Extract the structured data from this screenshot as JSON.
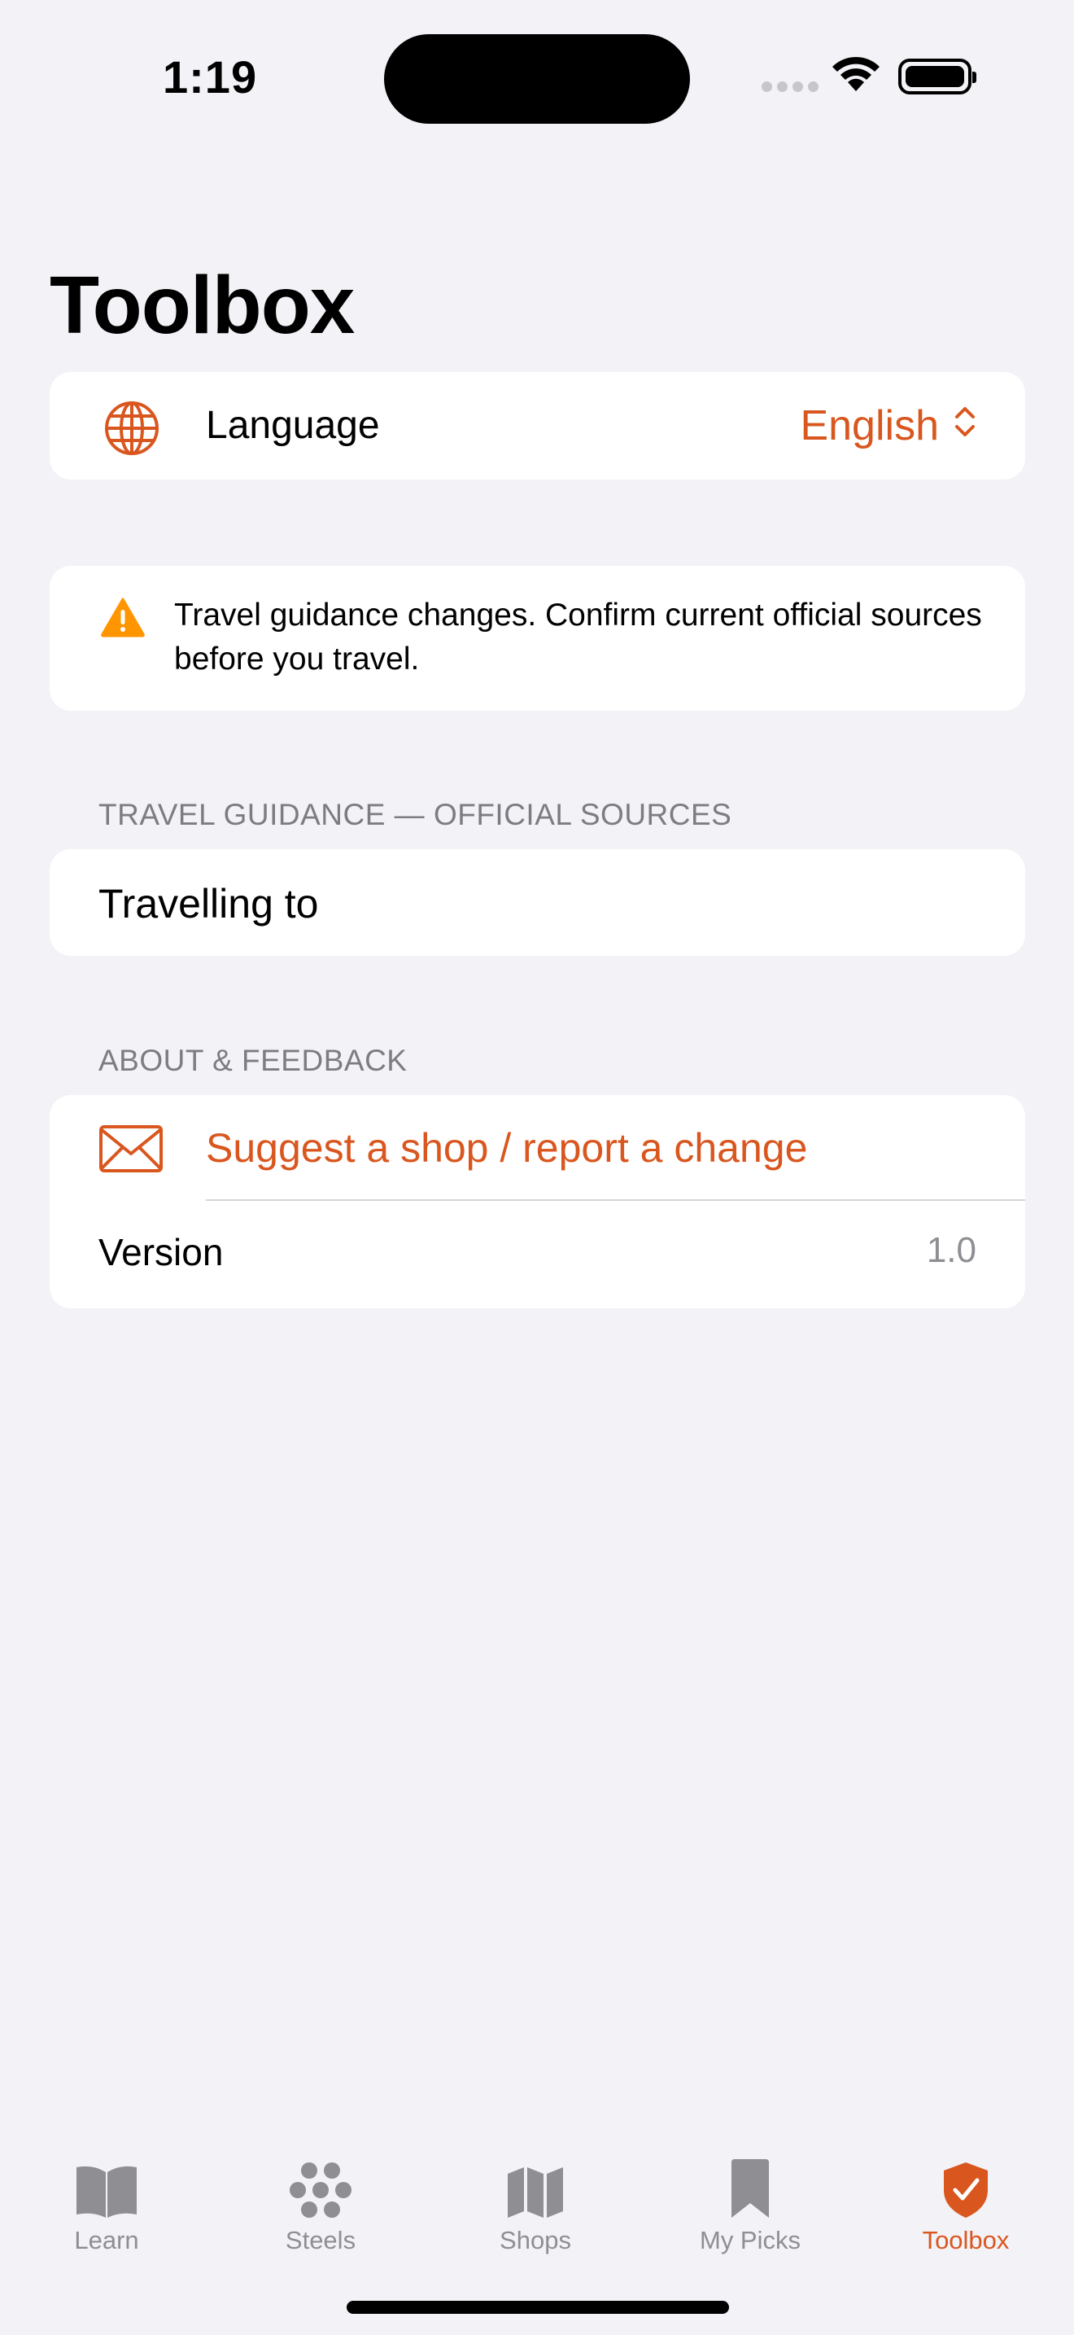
{
  "status_bar": {
    "time": "1:19"
  },
  "page": {
    "title": "Toolbox"
  },
  "language_row": {
    "label": "Language",
    "value": "English"
  },
  "notice": {
    "text": "Travel guidance changes. Confirm current official sources before you travel."
  },
  "travel_section": {
    "header": "TRAVEL GUIDANCE — OFFICIAL SOURCES",
    "row_label": "Travelling to"
  },
  "about_section": {
    "header": "ABOUT & FEEDBACK",
    "suggest_label": "Suggest a shop / report a change",
    "version_label": "Version",
    "version_value": "1.0"
  },
  "tabs": [
    {
      "label": "Learn",
      "icon": "book-icon"
    },
    {
      "label": "Steels",
      "icon": "hexagon-cluster-icon"
    },
    {
      "label": "Shops",
      "icon": "map-icon"
    },
    {
      "label": "My Picks",
      "icon": "bookmark-icon"
    },
    {
      "label": "Toolbox",
      "icon": "checkmark-shield-icon",
      "active": true
    }
  ],
  "colors": {
    "accent": "#D9571F",
    "warning": "#FF9500",
    "inactive": "#8E8E93",
    "background": "#F2F2F7"
  }
}
